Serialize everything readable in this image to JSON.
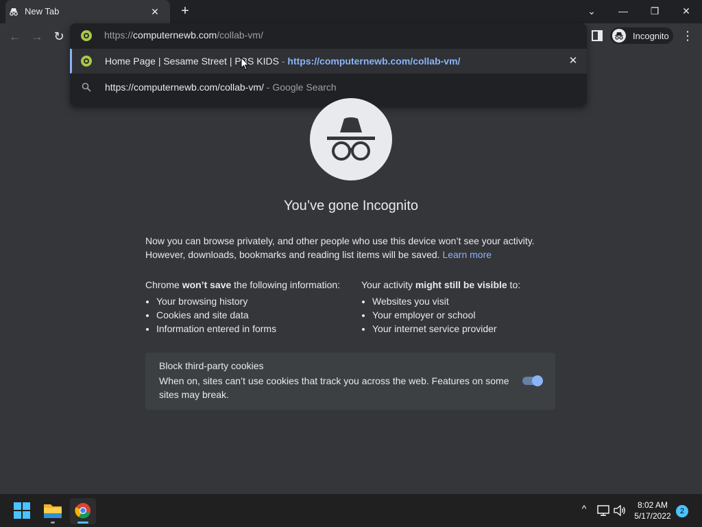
{
  "window": {
    "tab_title": "New Tab",
    "tab_close": "✕",
    "new_tab": "+",
    "controls": {
      "dropdown": "⌄",
      "minimize": "—",
      "restore": "❐",
      "close": "✕"
    }
  },
  "toolbar": {
    "back": "←",
    "forward": "→",
    "reload": "↻",
    "incognito_label": "Incognito",
    "menu": "⋮"
  },
  "omnibox": {
    "input_prefix": "https://",
    "input_host": "computernewb.com",
    "input_path": "/collab-vm/",
    "suggestions": [
      {
        "title": "Home Page | Sesame Street | PBS KIDS",
        "separator": " - ",
        "url": "https://computernewb.com/collab-vm/",
        "remove": "✕",
        "icon": "site-favicon"
      },
      {
        "text": "https://computernewb.com/collab-vm/",
        "suffix": " - Google Search",
        "icon": "search-icon"
      }
    ]
  },
  "content": {
    "heading": "You’ve gone Incognito",
    "intro_line1": "Now you can browse privately, and other people who use this device won’t see your activity.",
    "intro_line2": "However, downloads, bookmarks and reading list items will be saved.",
    "learn_more": "Learn more",
    "left_col": {
      "title_pre": "Chrome ",
      "title_bold": "won’t save",
      "title_post": " the following information:",
      "items": [
        "Your browsing history",
        "Cookies and site data",
        "Information entered in forms"
      ]
    },
    "right_col": {
      "title_pre": "Your activity ",
      "title_bold": "might still be visible",
      "title_post": " to:",
      "items": [
        "Websites you visit",
        "Your employer or school",
        "Your internet service provider"
      ]
    },
    "cookies": {
      "title": "Block third-party cookies",
      "description": "When on, sites can’t use cookies that track you across the web. Features on some sites may break.",
      "enabled": true
    }
  },
  "taskbar": {
    "time": "8:02 AM",
    "date": "5/17/2022",
    "notifications": "2",
    "tray_chevron": "^"
  },
  "colors": {
    "page_bg": "#35363a",
    "frame_bg": "#202124",
    "accent": "#8ab4f8",
    "taskbar_bg": "#202020"
  }
}
